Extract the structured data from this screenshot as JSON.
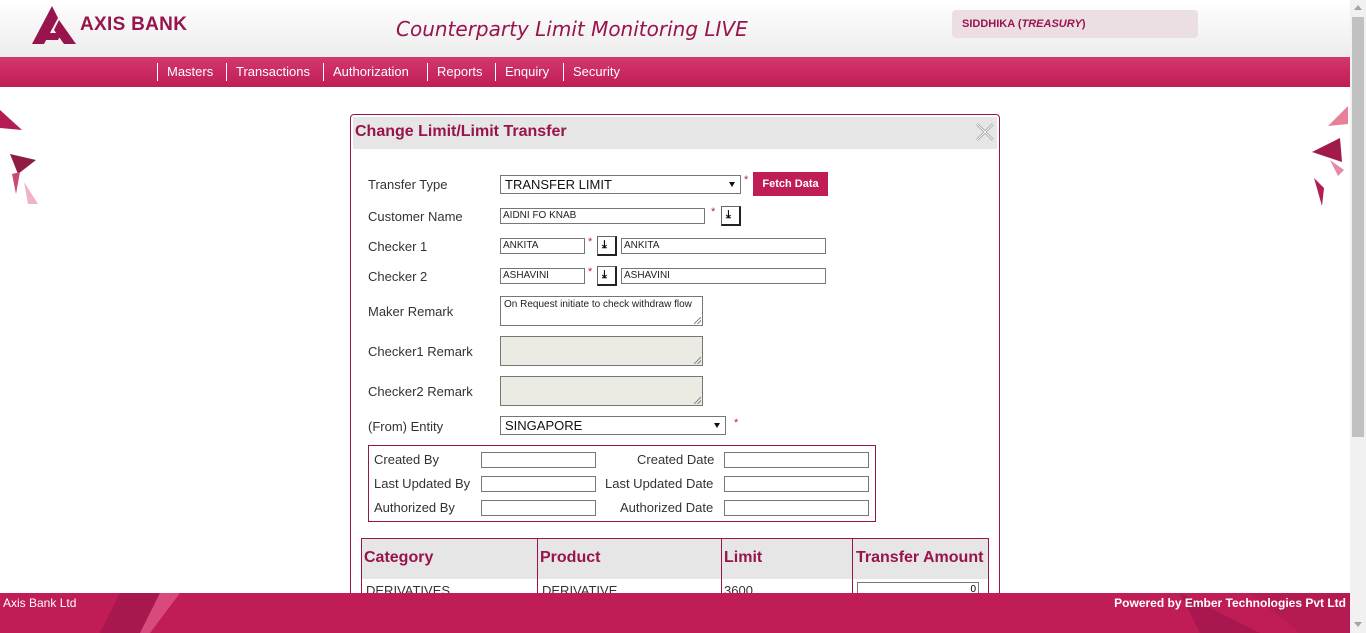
{
  "brand": {
    "name": "AXIS BANK"
  },
  "app": {
    "title": "Counterparty Limit Monitoring LIVE"
  },
  "user": {
    "name": "SIDDHIKA",
    "role": "TREASURY"
  },
  "nav": [
    "Masters",
    "Transactions",
    "Authorization",
    "Reports",
    "Enquiry",
    "Security"
  ],
  "dialog": {
    "title": "Change Limit/Limit Transfer",
    "transfer_type": {
      "label": "Transfer Type",
      "value": "TRANSFER LIMIT"
    },
    "fetch_button": "Fetch Data",
    "customer": {
      "label": "Customer Name",
      "value": "AIDNI FO KNAB"
    },
    "checker1": {
      "label": "Checker 1",
      "code": "ANKITA",
      "name": "ANKITA"
    },
    "checker2": {
      "label": "Checker 2",
      "code": "ASHAVINI",
      "name": "ASHAVINI"
    },
    "maker_remark": {
      "label": "Maker Remark",
      "value": "On Request initiate to check withdraw flow"
    },
    "checker1_remark": {
      "label": "Checker1 Remark",
      "value": ""
    },
    "checker2_remark": {
      "label": "Checker2 Remark",
      "value": ""
    },
    "entity": {
      "label": "(From) Entity",
      "value": "SINGAPORE"
    },
    "required_mark": "*",
    "audit": {
      "created_by": "Created By",
      "created_date": "Created Date",
      "last_updated_by": "Last Updated By",
      "last_updated_date": "Last Updated Date",
      "authorized_by": "Authorized By",
      "authorized_date": "Authorized Date"
    },
    "grid": {
      "headers": [
        "Category",
        "Product",
        "Limit",
        "Transfer Amount"
      ],
      "rows": [
        {
          "category": "DERIVATIVES",
          "product": "DERIVATIVE",
          "limit": "3600",
          "transfer_amount": "0"
        }
      ]
    }
  },
  "footer": {
    "left": "Axis Bank Ltd",
    "right": "Powered by Ember Technologies Pvt Ltd"
  },
  "colors": {
    "brand": "#97144d",
    "accent": "#c01c55"
  }
}
